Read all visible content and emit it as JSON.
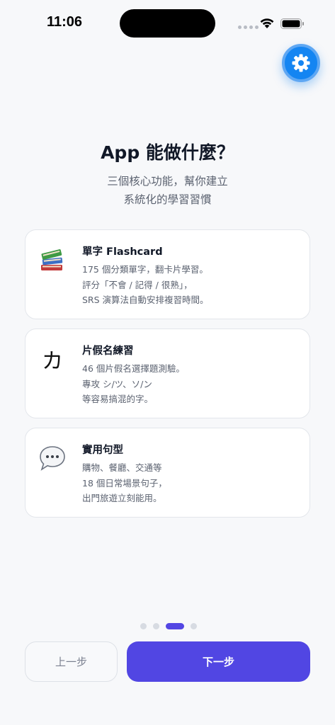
{
  "status_bar": {
    "time": "11:06"
  },
  "header": {
    "settings_icon": "gear-icon"
  },
  "intro": {
    "title": "App 能做什麼？",
    "subtitle_line1": "三個核心功能，幫你建立",
    "subtitle_line2": "系統化的學習習慣"
  },
  "features": [
    {
      "icon": "books-icon",
      "title": "單字 Flashcard",
      "lines": [
        "175 個分類單字，翻卡片學習。",
        "評分「不會 / 記得 / 很熟」，",
        "SRS 演算法自動安排複習時間。"
      ]
    },
    {
      "icon": "katakana-icon",
      "glyph": "カ",
      "title": "片假名練習",
      "lines": [
        "46 個片假名選擇題測驗。",
        "專攻 シ/ツ、ソ/ン",
        "等容易搞混的字。"
      ]
    },
    {
      "icon": "speech-bubble-icon",
      "title": "實用句型",
      "lines": [
        "購物、餐廳、交通等",
        "18 個日常場景句子，",
        "出門旅遊立刻能用。"
      ]
    }
  ],
  "pager": {
    "total": 4,
    "current": 3
  },
  "nav": {
    "prev_label": "上一步",
    "next_label": "下一步"
  },
  "colors": {
    "accent": "#5146e3",
    "settings_blue": "#1485f2",
    "background": "#f7f8fa"
  }
}
